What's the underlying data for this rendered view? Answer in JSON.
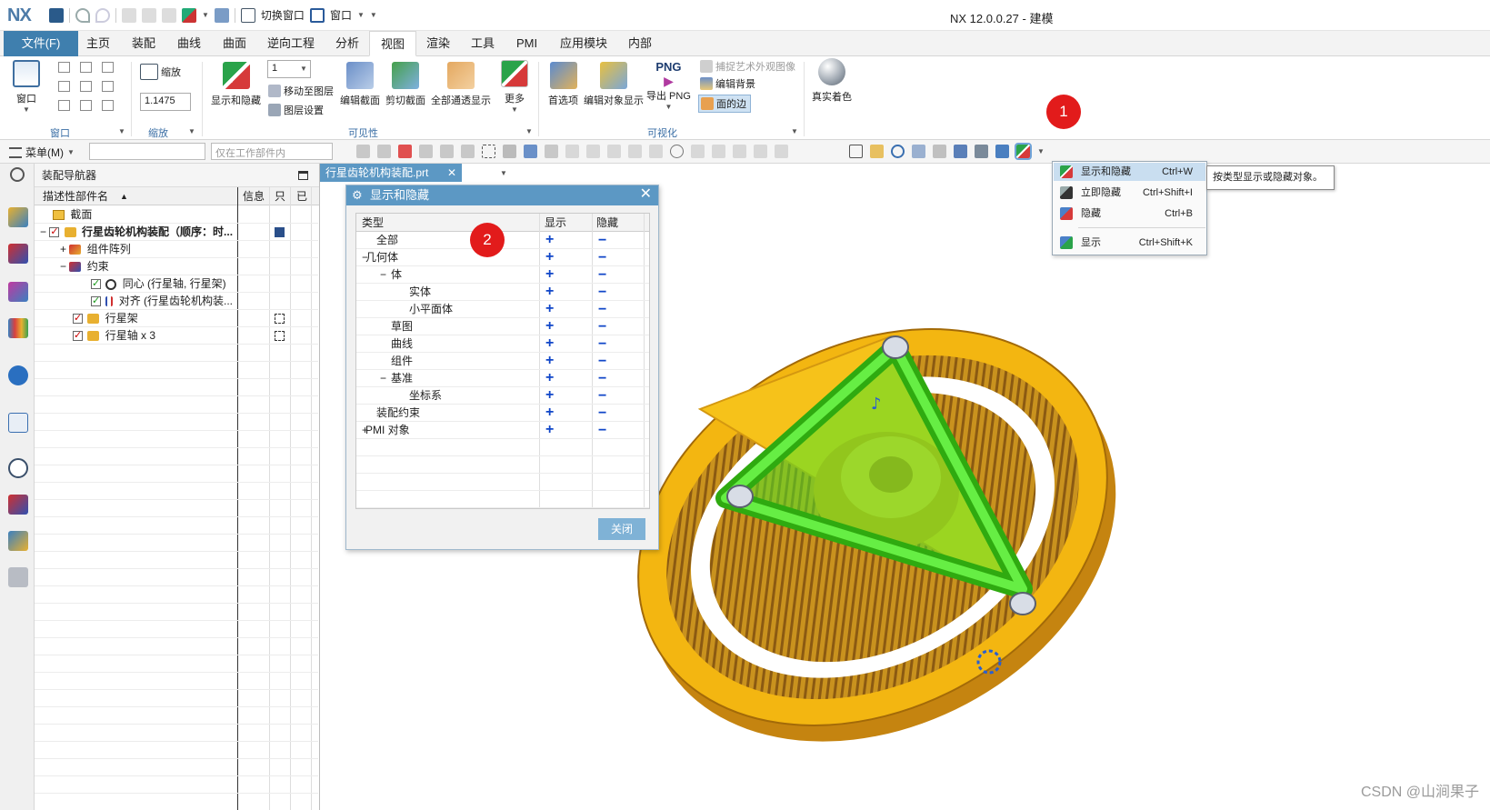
{
  "window": {
    "logo": "NX",
    "title": "NX 12.0.0.27 - 建模",
    "qat_switch_window": "切换窗口",
    "qat_window": "窗口"
  },
  "tabs": [
    "文件(F)",
    "主页",
    "装配",
    "曲线",
    "曲面",
    "逆向工程",
    "分析",
    "视图",
    "渲染",
    "工具",
    "PMI",
    "应用模块",
    "内部"
  ],
  "active_tab": "视图",
  "ribbon": {
    "window_btn": "窗口",
    "zoom_btn": "缩放",
    "zoom_value": "1.1475",
    "show_hide": "显示和隐藏",
    "layer_combo": "1",
    "move_to_layer": "移动至图层",
    "layer_settings": "图层设置",
    "edit_section": "编辑截面",
    "clip_section": "剪切截面",
    "show_all_through": "全部通透显示",
    "more": "更多",
    "preferences": "首选项",
    "edit_object_display": "编辑对象显示",
    "export_png_top": "PNG",
    "export_png": "导出 PNG",
    "capture_art": "捕捉艺术外观图像",
    "edit_background": "编辑背景",
    "face_edges": "面的边",
    "true_shading": "真实着色",
    "groups": {
      "window": "窗口",
      "zoom": "缩放",
      "visibility": "可见性",
      "visualization": "可视化"
    }
  },
  "toolbar": {
    "menu": "菜单(M)",
    "filter_placeholder": "仅在工作部件内"
  },
  "navigator": {
    "title": "装配导航器",
    "col_name": "描述性部件名",
    "col_info": "信息",
    "col_readonly": "只",
    "col_modified": "已",
    "rows": [
      {
        "label": "截面"
      },
      {
        "label": "行星齿轮机构装配（顺序：时..."
      },
      {
        "label": "组件阵列"
      },
      {
        "label": "约束"
      },
      {
        "label": "同心 (行星轴, 行星架)"
      },
      {
        "label": "对齐 (行星齿轮机构装..."
      },
      {
        "label": "行星架"
      },
      {
        "label": "行星轴 x 3"
      }
    ]
  },
  "graphics": {
    "part_tab": "行星齿轮机构装配.prt"
  },
  "dialog": {
    "title": "显示和隐藏",
    "col_type": "类型",
    "col_show": "显示",
    "col_hide": "隐藏",
    "rows": [
      {
        "label": "全部"
      },
      {
        "label": "几何体"
      },
      {
        "label": "体"
      },
      {
        "label": "实体"
      },
      {
        "label": "小平面体"
      },
      {
        "label": "草图"
      },
      {
        "label": "曲线"
      },
      {
        "label": "组件"
      },
      {
        "label": "基准"
      },
      {
        "label": "坐标系"
      },
      {
        "label": "装配约束"
      },
      {
        "label": "PMI 对象"
      }
    ],
    "show_symbol": "+",
    "hide_symbol": "−",
    "close_btn": "关闭"
  },
  "dropdown": {
    "items": [
      {
        "label": "显示和隐藏",
        "shortcut": "Ctrl+W",
        "icon": "show-hide-icon"
      },
      {
        "label": "立即隐藏",
        "shortcut": "Ctrl+Shift+I",
        "icon": "immediate-hide-icon"
      },
      {
        "label": "隐藏",
        "shortcut": "Ctrl+B",
        "icon": "hide-icon"
      },
      {
        "label": "显示",
        "shortcut": "Ctrl+Shift+K",
        "icon": "show-icon"
      }
    ],
    "tooltip": "按类型显示或隐藏对象。"
  },
  "annotations": {
    "badge1": "1",
    "badge2": "2"
  },
  "watermark": "CSDN @山涧果子",
  "colors": {
    "accent": "#3f7fae",
    "gear": "#f0b400",
    "carrier": "#44dd22",
    "badge": "#e21b1b"
  }
}
